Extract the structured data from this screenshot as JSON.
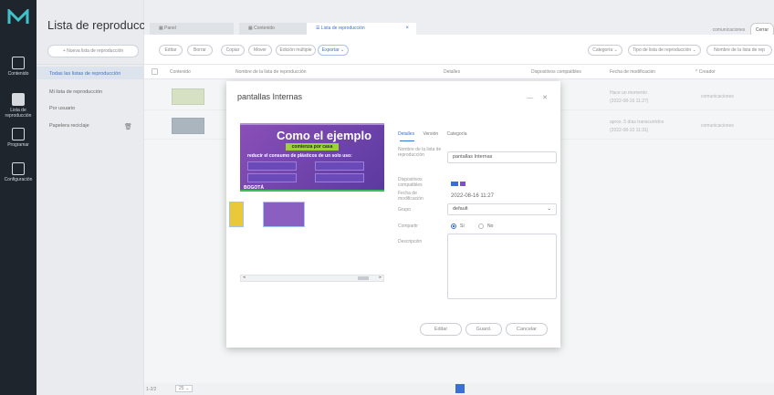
{
  "rail": {
    "items": [
      {
        "label": "Contenido",
        "icon": "grid-icon"
      },
      {
        "label": "Lista de reproducción",
        "icon": "playlist-icon"
      },
      {
        "label": "Programar",
        "icon": "calendar-icon"
      },
      {
        "label": "Configuración",
        "icon": "settings-icon"
      }
    ]
  },
  "subpanel": {
    "title": "Lista de reproducción",
    "new_button": "+ Nueva lista de reproducción",
    "items": [
      "Todas las listas de reproducción",
      "Mi lista de reproducción",
      "Por usuario",
      "Papelera reciclaje"
    ]
  },
  "tabs": [
    {
      "label": "Panel"
    },
    {
      "label": "Contenido",
      "close": "×"
    },
    {
      "label": "Lista de reproducción",
      "close": "×"
    }
  ],
  "topright": {
    "user": "comunicaciones",
    "logout": "Cerrar"
  },
  "toolbar": {
    "buttons": [
      "Editar",
      "Borrar",
      "Copiar",
      "Mover",
      "Edición múltiple",
      "Exportar ⌄"
    ],
    "category": "Categoría ⌄",
    "type_filter": "Tipo de lista de reproducción ⌄",
    "name_filter": "Nombre de la lista de rep"
  },
  "table": {
    "headers": [
      "Contenido",
      "Nombre de la lista de reproducción",
      "Detalles",
      "Dispositivos compatibles",
      "Fecha de modificación",
      "^ Creador"
    ],
    "rows": [
      {
        "date1": "Hace un momento",
        "date2": "(2022-08-16 11:27)",
        "creator": "comunicaciones"
      },
      {
        "date1": "aprox. 5 días transcurridos",
        "date2": "(2022-08-10 11:31)",
        "creator": "comunicaciones"
      }
    ]
  },
  "footer": {
    "pagination": "1-2/2",
    "per_page": "25 ⌄"
  },
  "modal": {
    "title": "pantallas Internas",
    "controls": "— ✕",
    "preview": {
      "headline": "Como el ejemplo",
      "subhead": "comienza por casa",
      "tagline": "reducir el consumo de plásticos de un solo uso:",
      "logo": "BOGOTÁ"
    },
    "tabs": [
      "Detalles",
      "Versión",
      "Categoría"
    ],
    "fields": {
      "name_label": "Nombre de la lista de reproducción",
      "name_value": "pantallas Internas",
      "devices_label": "Dispositivos compatibles",
      "date_label": "Fecha de modificación",
      "date_value": "2022-08-16 11:27",
      "group_label": "Grupo",
      "group_value": "default",
      "share_label": "Compartir",
      "share_yes": "Sí",
      "share_no": "No",
      "desc_label": "Descripción"
    },
    "buttons": {
      "edit": "Editar",
      "save": "Guard.",
      "cancel": "Cancelar"
    }
  },
  "colors": {
    "accent": "#3a6fd8",
    "rail": "#1f252d"
  }
}
